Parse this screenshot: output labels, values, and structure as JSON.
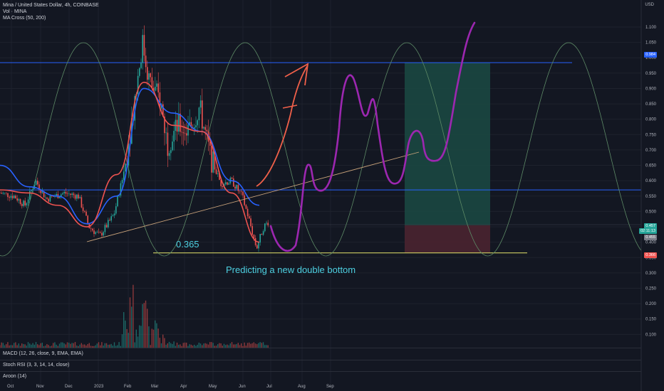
{
  "header": {
    "symbol_line": "Mina / United States Dollar, 4h, COINBASE",
    "vol_line": "Vol · MINA",
    "ma_line": "MA Cross (50, 200)"
  },
  "currency": "USD",
  "panes": {
    "macd": "MACD (12, 26, close, 9, EMA, EMA)",
    "stoch": "Stoch RSI (3, 3, 14, 14, close)",
    "aroon": "Aroon (14)"
  },
  "annotations": {
    "level_label": "0.365",
    "prediction": "Predicting a new double bottom"
  },
  "price_tags": {
    "top": "0.984",
    "current": "0.457",
    "current_sub": "02:11:13",
    "mid": "0.455",
    "bottom": "0.366"
  },
  "colors": {
    "background": "#131722",
    "grid": "#1e222d",
    "candle_up": "#26a69a",
    "candle_down": "#ef5350",
    "ma_fast": "#ef5350",
    "ma_slow": "#2962ff",
    "sine": "#5d8a66",
    "horizontal_line": "#2962ff",
    "support_line": "#e6e66a",
    "trendline": "#c8a27a",
    "prediction_path": "#9c27b0",
    "red_arrow": "#f0604a",
    "profit_zone": "#1b4a43",
    "loss_zone": "#4a2330"
  },
  "chart_data": {
    "type": "line",
    "title": "Mina / United States Dollar, 4h, COINBASE",
    "xlabel": "",
    "ylabel": "USD",
    "ylim": [
      0.08,
      1.13
    ],
    "y_ticks": [
      "1.100",
      "1.050",
      "1.000",
      "0.950",
      "0.900",
      "0.850",
      "0.800",
      "0.750",
      "0.700",
      "0.650",
      "0.600",
      "0.550",
      "0.500",
      "0.450",
      "0.400",
      "0.350",
      "0.300",
      "0.250",
      "0.200",
      "0.150",
      "0.100"
    ],
    "x_ticks": [
      "Oct",
      "Nov",
      "Dec",
      "2023",
      "Feb",
      "Mar",
      "Apr",
      "May",
      "Jun",
      "Jul",
      "Aug",
      "Sep"
    ],
    "horizontal_levels": [
      0.984,
      0.57,
      0.365
    ],
    "position": {
      "entry": 0.455,
      "target": 0.984,
      "stop": 0.366
    },
    "price_series": {
      "name": "MINA",
      "x": [
        "Oct",
        "Nov",
        "Dec",
        "2023",
        "Feb",
        "Mar",
        "Apr",
        "May",
        "Jun",
        "Jul"
      ],
      "values": [
        0.56,
        0.57,
        0.52,
        0.43,
        0.68,
        0.98,
        0.78,
        0.76,
        0.55,
        0.37
      ]
    },
    "ma_fast": {
      "name": "MA 50",
      "x": [
        "Oct",
        "Nov",
        "Dec",
        "2023",
        "Feb",
        "Mar",
        "Apr",
        "May",
        "Jun",
        "Jul"
      ],
      "values": [
        0.57,
        0.56,
        0.52,
        0.45,
        0.62,
        0.92,
        0.78,
        0.76,
        0.56,
        0.4
      ]
    },
    "ma_slow": {
      "name": "MA 200",
      "x": [
        "Oct",
        "Nov",
        "Dec",
        "2023",
        "Feb",
        "Mar",
        "Apr",
        "May",
        "Jun",
        "Jul"
      ],
      "values": [
        0.65,
        0.58,
        0.55,
        0.46,
        0.55,
        0.9,
        0.82,
        0.76,
        0.6,
        0.52
      ]
    },
    "volume_series": {
      "name": "Vol",
      "x": [
        "Oct",
        "Nov",
        "Dec",
        "2023",
        "Feb",
        "Mar",
        "Apr",
        "May",
        "Jun",
        "Jul"
      ],
      "values": [
        0.01,
        0.02,
        0.01,
        0.03,
        0.23,
        0.08,
        0.06,
        0.04,
        0.05,
        0.02
      ]
    }
  }
}
